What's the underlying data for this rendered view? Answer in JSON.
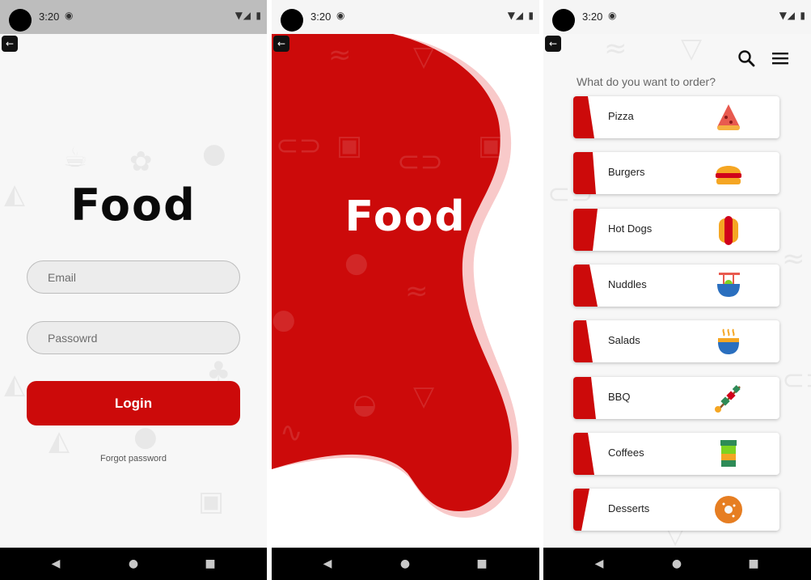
{
  "status_bar": {
    "time": "3:20"
  },
  "login": {
    "logo": "Food",
    "email_placeholder": "Email",
    "password_placeholder": "Passowrd",
    "login_label": "Login",
    "forgot_label": "Forgot password"
  },
  "splash": {
    "logo": "Food"
  },
  "menu": {
    "question": "What do you want to order?",
    "items": [
      {
        "label": "Pizza",
        "icon": "pizza-icon"
      },
      {
        "label": "Burgers",
        "icon": "burger-icon"
      },
      {
        "label": "Hot Dogs",
        "icon": "hotdog-icon"
      },
      {
        "label": "Nuddles",
        "icon": "noodles-icon"
      },
      {
        "label": "Salads",
        "icon": "salad-icon"
      },
      {
        "label": "BBQ",
        "icon": "bbq-icon"
      },
      {
        "label": "Coffees",
        "icon": "coffee-icon"
      },
      {
        "label": "Desserts",
        "icon": "donut-icon"
      }
    ]
  },
  "colors": {
    "accent_red": "#cc0a0a",
    "blob_shadow": "#f8c9c9",
    "background": "#f7f7f7"
  }
}
